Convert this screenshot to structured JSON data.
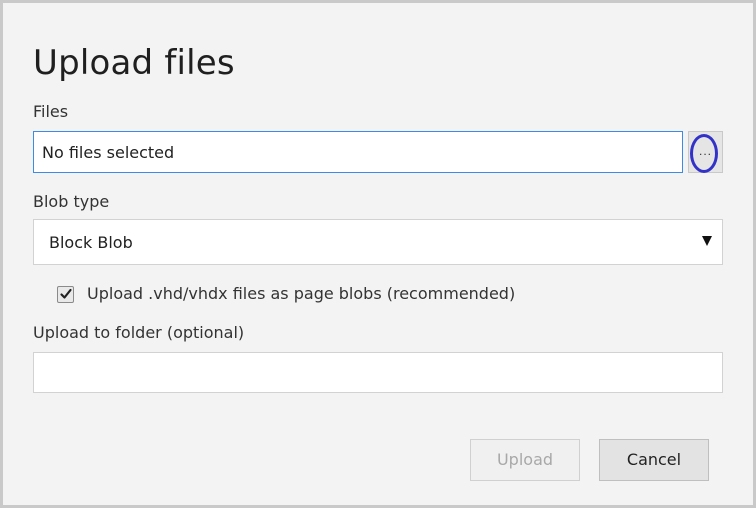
{
  "dialog": {
    "title": "Upload files"
  },
  "files": {
    "label": "Files",
    "value": "No files selected",
    "browse_label": "..."
  },
  "blob_type": {
    "label": "Blob type",
    "selected": "Block Blob"
  },
  "page_blob_option": {
    "label": "Upload .vhd/vhdx files as page blobs (recommended)",
    "checked": true
  },
  "folder": {
    "label": "Upload to folder (optional)",
    "value": ""
  },
  "actions": {
    "upload_label": "Upload",
    "upload_enabled": false,
    "cancel_label": "Cancel"
  },
  "colors": {
    "focus_border": "#3c8ce7",
    "highlight_ring": "#3232c8",
    "dialog_background": "#f3f3f3"
  }
}
